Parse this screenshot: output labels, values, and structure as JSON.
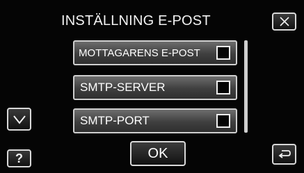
{
  "header": {
    "title": "INSTÄLLNING E-POST",
    "close_icon": "close-icon"
  },
  "list": {
    "items": [
      {
        "label": "MOTTAGARENS E-POST",
        "checked": false
      },
      {
        "label": "SMTP-SERVER",
        "checked": false
      },
      {
        "label": "SMTP-PORT",
        "checked": false
      }
    ],
    "scroll_down_icon": "chevron-down-icon"
  },
  "footer": {
    "ok_label": "OK",
    "help_label": "?",
    "back_icon": "return-icon"
  },
  "colors": {
    "background": "#050505",
    "item_fill": "#4a4a4a",
    "border": "#cfcfcf",
    "text": "#ffffff"
  }
}
